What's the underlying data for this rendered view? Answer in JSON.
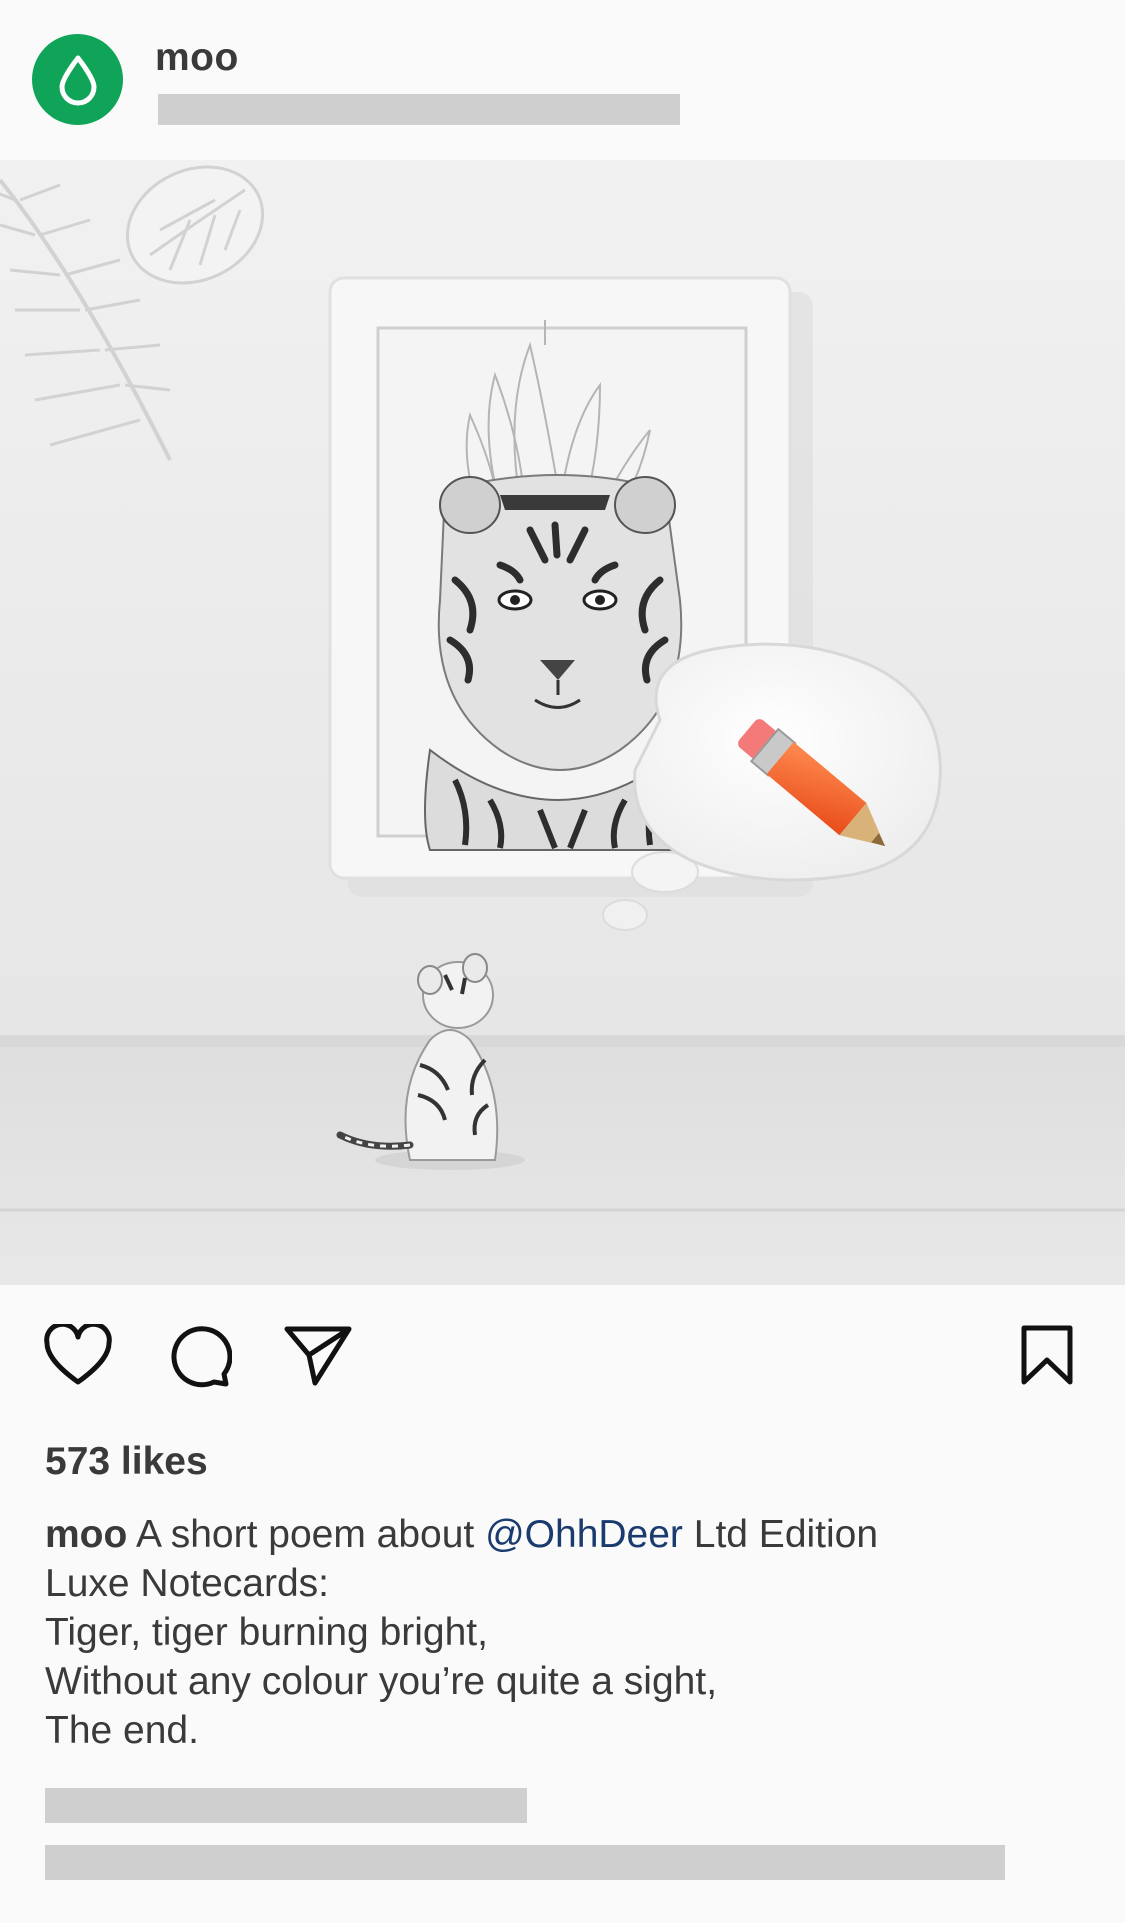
{
  "post": {
    "username": "moo",
    "likes_text": "573 likes",
    "caption": {
      "username": "moo",
      "text_start": "A short poem about ",
      "mention": "@OhhDeer",
      "text_end": " Ltd Edition",
      "lines": [
        "Luxe Notecards:",
        "Tiger, tiger burning bright,",
        "Without any colour you’re quite a sight,",
        "The end."
      ]
    }
  },
  "colors": {
    "brand": "#0fa457",
    "mention": "#1a3b6e",
    "placeholder": "#cfcfcf",
    "pencil": "#f5642a"
  },
  "icons": {
    "avatar": "drop-icon",
    "like": "heart-icon",
    "comment": "comment-icon",
    "share": "paper-plane-icon",
    "save": "bookmark-icon"
  }
}
